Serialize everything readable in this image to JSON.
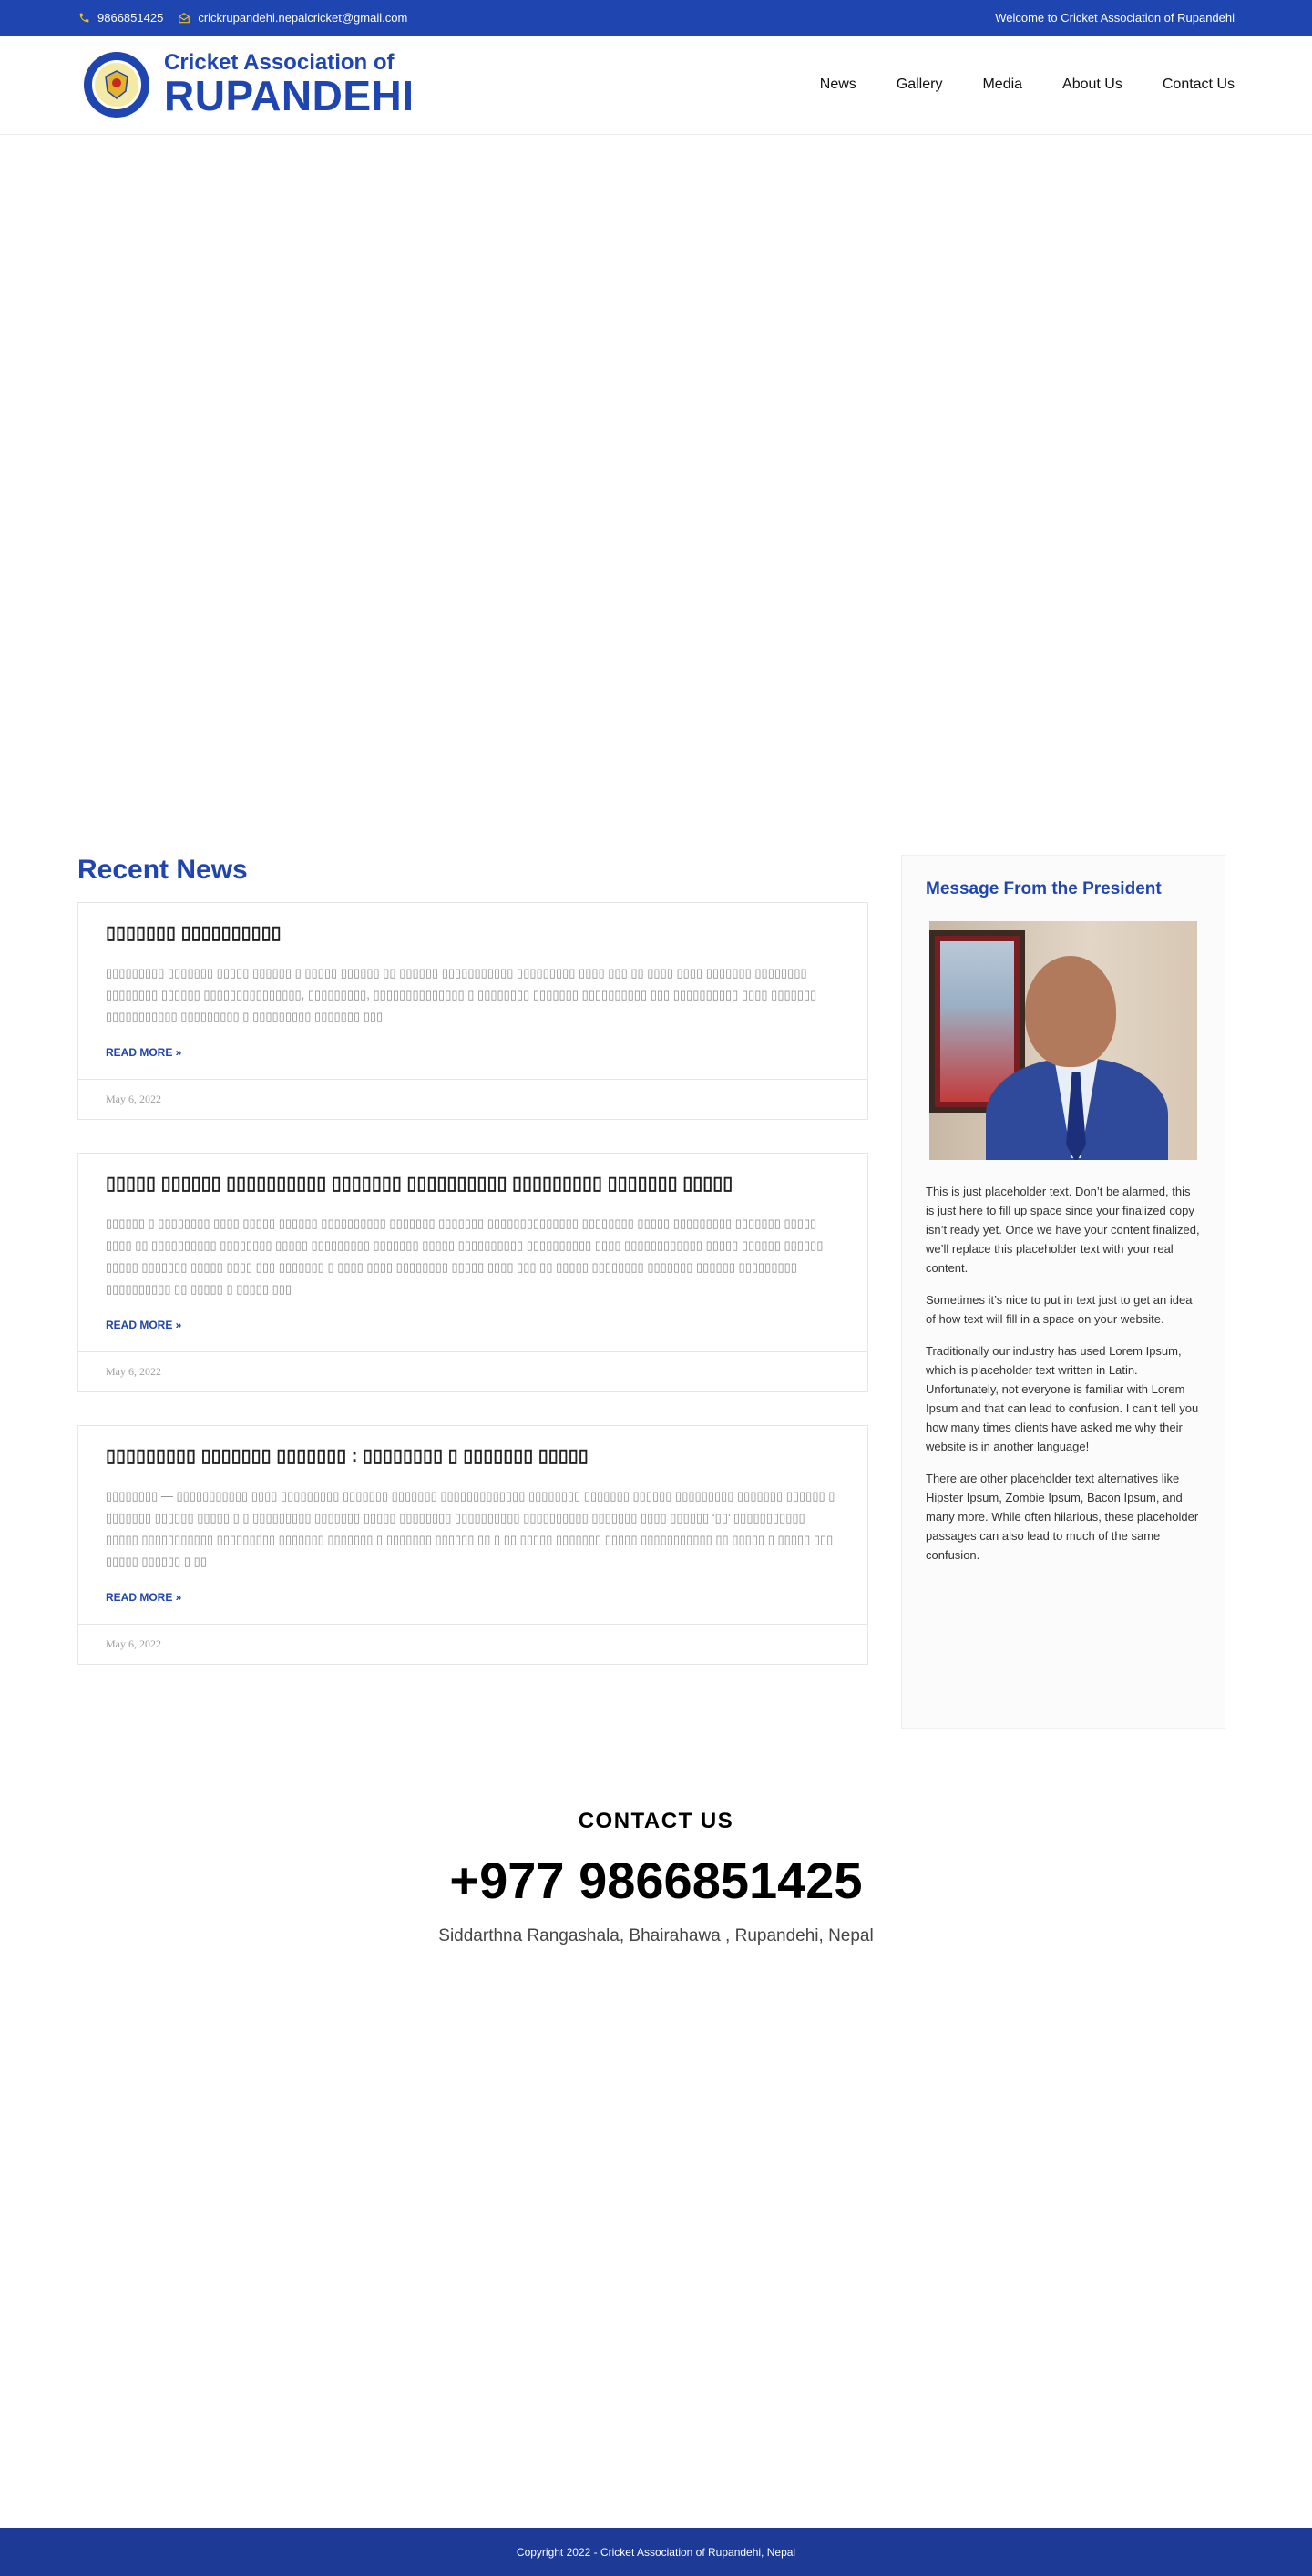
{
  "topbar": {
    "phone": "9866851425",
    "email": "crickrupandehi.nepalcricket@gmail.com",
    "welcome": "Welcome to Cricket Association of Rupandehi"
  },
  "header": {
    "brand_line1": "Cricket Association of",
    "brand_line2": "RUPANDEHI",
    "nav": [
      "News",
      "Gallery",
      "Media",
      "About Us",
      "Contact Us"
    ]
  },
  "news": {
    "title": "Recent News",
    "posts": [
      {
        "title": "▯▯▯▯▯▯▯ ▯▯▯▯▯▯▯▯▯▯",
        "excerpt": "▯▯▯▯▯▯▯▯▯ ▯▯▯▯▯▯▯ ▯▯▯▯▯ ▯▯▯▯▯▯ ▯ ▯▯▯▯▯ ▯▯▯▯▯▯ ▯▯ ▯▯▯▯▯▯ ▯▯▯▯▯▯▯▯▯▯▯ ▯▯▯▯▯▯▯▯▯ ▯▯▯▯ ▯▯▯ ▯▯ ▯▯▯▯ ▯▯▯▯ ▯▯▯▯▯▯▯ ▯▯▯▯▯▯▯▯ ▯▯▯▯▯▯▯▯ ▯▯▯▯▯▯ ▯▯▯▯▯▯▯▯▯▯▯▯▯▯▯, ▯▯▯▯▯▯▯▯▯, ▯▯▯▯▯▯▯▯▯▯▯▯▯▯ ▯ ▯▯▯▯▯▯▯▯ ▯▯▯▯▯▯▯ ▯▯▯▯▯▯▯▯▯▯ ▯▯▯ ▯▯▯▯▯▯▯▯▯▯ ▯▯▯▯ ▯▯▯▯▯▯▯ ▯▯▯▯▯▯▯▯▯▯▯ ▯▯▯▯▯▯▯▯▯ ▯ ▯▯▯▯▯▯▯▯▯ ▯▯▯▯▯▯▯ ▯▯▯",
        "more": "READ MORE »",
        "date": "May 6, 2022"
      },
      {
        "title": "▯▯▯▯▯ ▯▯▯▯▯▯ ▯▯▯▯▯▯▯▯▯▯ ▯▯▯▯▯▯▯ ▯▯▯▯▯▯▯▯▯▯ ▯▯▯▯▯▯▯▯▯ ▯▯▯▯▯▯▯ ▯▯▯▯▯",
        "excerpt": "▯▯▯▯▯▯ ▯ ▯▯▯▯▯▯▯▯ ▯▯▯▯ ▯▯▯▯▯ ▯▯▯▯▯▯ ▯▯▯▯▯▯▯▯▯▯ ▯▯▯▯▯▯▯ ▯▯▯▯▯▯▯ ▯▯▯▯▯▯▯▯▯▯▯▯▯▯ ▯▯▯▯▯▯▯▯ ▯▯▯▯▯ ▯▯▯▯▯▯▯▯▯ ▯▯▯▯▯▯▯ ▯▯▯▯▯ ▯▯▯▯ ▯▯ ▯▯▯▯▯▯▯▯▯▯ ▯▯▯▯▯▯▯▯ ▯▯▯▯▯ ▯▯▯▯▯▯▯▯▯ ▯▯▯▯▯▯▯ ▯▯▯▯▯ ▯▯▯▯▯▯▯▯▯▯ ▯▯▯▯▯▯▯▯▯▯ ▯▯▯▯ ▯▯▯▯▯▯▯▯▯▯▯▯ ▯▯▯▯▯ ▯▯▯▯▯▯ ▯▯▯▯▯▯ ▯▯▯▯▯ ▯▯▯▯▯▯▯ ▯▯▯▯▯ ▯▯▯▯ ▯▯▯ ▯▯▯▯▯▯▯ ▯ ▯▯▯▯ ▯▯▯▯ ▯▯▯▯▯▯▯▯ ▯▯▯▯▯ ▯▯▯▯ ▯▯▯ ▯▯ ▯▯▯▯▯ ▯▯▯▯▯▯▯▯ ▯▯▯▯▯▯▯ ▯▯▯▯▯▯ ▯▯▯▯▯▯▯▯▯ ▯▯▯▯▯▯▯▯▯▯ ▯▯ ▯▯▯▯▯ ▯ ▯▯▯▯▯ ▯▯▯",
        "more": "READ MORE »",
        "date": "May 6, 2022"
      },
      {
        "title": "▯▯▯▯▯▯▯▯▯ ▯▯▯▯▯▯▯ ▯▯▯▯▯▯▯ : ▯▯▯▯▯▯▯▯ ▯ ▯▯▯▯▯▯▯ ▯▯▯▯▯",
        "excerpt": "▯▯▯▯▯▯▯▯ — ▯▯▯▯▯▯▯▯▯▯▯ ▯▯▯▯ ▯▯▯▯▯▯▯▯▯ ▯▯▯▯▯▯▯ ▯▯▯▯▯▯▯ ▯▯▯▯▯▯▯▯▯▯▯▯▯ ▯▯▯▯▯▯▯▯ ▯▯▯▯▯▯▯ ▯▯▯▯▯▯ ▯▯▯▯▯▯▯▯▯ ▯▯▯▯▯▯▯ ▯▯▯▯▯▯ ▯ ▯▯▯▯▯▯▯ ▯▯▯▯▯▯ ▯▯▯▯▯ ▯ ▯ ▯▯▯▯▯▯▯▯▯ ▯▯▯▯▯▯▯ ▯▯▯▯▯ ▯▯▯▯▯▯▯▯ ▯▯▯▯▯▯▯▯▯▯ ▯▯▯▯▯▯▯▯▯▯ ▯▯▯▯▯▯▯ ▯▯▯▯ ▯▯▯▯▯▯ ‘▯▯’ ▯▯▯▯▯▯▯▯▯▯▯ ▯▯▯▯▯ ▯▯▯▯▯▯▯▯▯▯▯ ▯▯▯▯▯▯▯▯▯ ▯▯▯▯▯▯▯ ▯▯▯▯▯▯▯ ▯ ▯▯▯▯▯▯▯ ▯▯▯▯▯▯ ▯▯ ▯ ▯▯ ▯▯▯▯▯ ▯▯▯▯▯▯▯ ▯▯▯▯▯ ▯▯▯▯▯▯▯▯▯▯▯ ▯▯ ▯▯▯▯▯ ▯ ▯▯▯▯▯ ▯▯▯ ▯▯▯▯▯ ▯▯▯▯▯▯ ▯ ▯▯",
        "more": "READ MORE »",
        "date": "May 6, 2022"
      }
    ]
  },
  "sidebar": {
    "title": "Message From the President",
    "paragraphs": [
      "This is just placeholder text. Don’t be alarmed, this is just here to fill up space since your finalized copy isn’t ready yet. Once we have your content finalized, we’ll replace this placeholder text with your real content.",
      "Sometimes it’s nice to put in text just to get an idea of how text will fill in a space on your website.",
      "Traditionally our industry has used Lorem Ipsum, which is placeholder text written in Latin. Unfortunately, not everyone is familiar with Lorem Ipsum and that can lead to confusion. I can’t tell you how many times clients have asked me why their website is in another language!",
      "There are other placeholder text alternatives like Hipster Ipsum, Zombie Ipsum, Bacon Ipsum, and many more. While often hilarious, these placeholder passages can also lead to much of the same confusion."
    ]
  },
  "contact": {
    "title": "CONTACT US",
    "phone": "+977 9866851425",
    "address": "Siddarthna Rangashala, Bhairahawa , Rupandehi, Nepal"
  },
  "footer": {
    "copyright": "Copyright 2022 - Cricket Association of Rupandehi, Nepal"
  },
  "colors": {
    "brand_blue": "#1f45b0",
    "footer_blue": "#1c3a96",
    "phone_icon_yellow": "#f4c20d"
  },
  "icons": [
    "phone-icon",
    "envelope-icon",
    "logo-emblem"
  ]
}
